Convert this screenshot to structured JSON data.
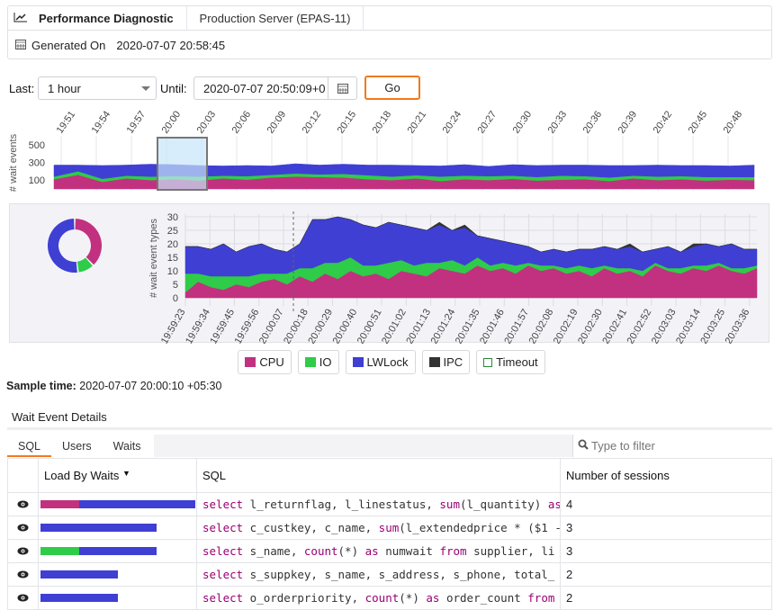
{
  "header": {
    "breadcrumb": [
      "Performance Diagnostic",
      "Production Server (EPAS-11)"
    ],
    "generated_label": "Generated On",
    "generated_value": "2020-07-07 20:58:45"
  },
  "controls": {
    "last_label": "Last:",
    "last_value": "1 hour",
    "until_label": "Until:",
    "until_value": "2020-07-07 20:50:09+0",
    "go_label": "Go"
  },
  "colors": {
    "CPU": "#c2317f",
    "IO": "#2ecc48",
    "LWLock": "#3f3fd4",
    "IPC": "#333333",
    "accent": "#f07a1e"
  },
  "chart_data": [
    {
      "type": "area",
      "stacked": true,
      "ylabel": "# wait events",
      "yticks": [
        100,
        300,
        500
      ],
      "ylim": [
        0,
        580
      ],
      "xticks": [
        "19:51",
        "19:54",
        "19:57",
        "20:00",
        "20:03",
        "20:06",
        "20:09",
        "20:12",
        "20:15",
        "20:18",
        "20:21",
        "20:24",
        "20:27",
        "20:30",
        "20:33",
        "20:36",
        "20:39",
        "20:42",
        "20:45",
        "20:48"
      ],
      "selection": [
        "20:00",
        "20:03"
      ],
      "series": [
        {
          "name": "CPU",
          "values": [
            110,
            160,
            80,
            120,
            100,
            110,
            95,
            120,
            105,
            130,
            140,
            135,
            130,
            110,
            100,
            120,
            90,
            110,
            100,
            115,
            95,
            105,
            110,
            90,
            120,
            100,
            110,
            95,
            105,
            100
          ]
        },
        {
          "name": "IO",
          "values": [
            30,
            40,
            35,
            30,
            40,
            35,
            45,
            30,
            40,
            30,
            35,
            30,
            40,
            45,
            40,
            35,
            50,
            40,
            45,
            35,
            40,
            45,
            35,
            40,
            30,
            40,
            35,
            40,
            30,
            35
          ]
        },
        {
          "name": "LWLock",
          "values": [
            130,
            70,
            150,
            120,
            140,
            130,
            125,
            110,
            120,
            100,
            110,
            105,
            110,
            115,
            130,
            110,
            120,
            125,
            110,
            125,
            130,
            120,
            125,
            135,
            115,
            130,
            120,
            130,
            125,
            135
          ]
        }
      ]
    },
    {
      "type": "area",
      "stacked": true,
      "ylabel": "# wait event types",
      "yticks": [
        0,
        5,
        10,
        15,
        20,
        25,
        30
      ],
      "ylim": [
        -3,
        31
      ],
      "xticks": [
        "19:59:23",
        "19:59:34",
        "19:59:45",
        "19:59:56",
        "20:00:07",
        "20:00:18",
        "20:00:29",
        "20:00:40",
        "20:00:51",
        "20:01:02",
        "20:01:13",
        "20:01:24",
        "20:01:35",
        "20:01:46",
        "20:01:57",
        "20:02:08",
        "20:02:19",
        "20:02:30",
        "20:02:41",
        "20:02:52",
        "20:03:03",
        "20:03:14",
        "20:03:25",
        "20:03:36"
      ],
      "marker": "20:00:10",
      "series": [
        {
          "name": "CPU",
          "values": [
            2,
            6,
            4,
            3,
            5,
            4,
            6,
            7,
            5,
            8,
            6,
            9,
            7,
            10,
            8,
            9,
            7,
            10,
            9,
            8,
            11,
            10,
            9,
            12,
            10,
            11,
            9,
            12,
            10,
            11,
            9,
            10,
            8,
            11,
            9,
            10,
            8,
            12,
            10,
            9,
            11,
            10,
            12,
            10,
            9,
            11
          ]
        },
        {
          "name": "IO",
          "values": [
            7,
            3,
            4,
            5,
            3,
            4,
            3,
            2,
            4,
            3,
            5,
            4,
            6,
            5,
            4,
            3,
            6,
            4,
            3,
            5,
            2,
            4,
            3,
            3,
            2,
            2,
            3,
            1,
            2,
            1,
            2,
            2,
            3,
            1,
            2,
            1,
            2,
            1,
            1,
            2,
            1,
            2,
            1,
            1,
            2,
            1
          ]
        },
        {
          "name": "LWLock",
          "values": [
            10,
            10,
            10,
            12,
            9,
            11,
            11,
            9,
            8,
            9,
            18,
            16,
            17,
            14,
            15,
            14,
            15,
            13,
            14,
            12,
            14,
            11,
            14,
            8,
            10,
            8,
            8,
            6,
            5,
            6,
            6,
            6,
            7,
            7,
            7,
            8,
            7,
            5,
            8,
            6,
            7,
            8,
            6,
            9,
            7,
            6
          ]
        },
        {
          "name": "IPC",
          "values": [
            0,
            0,
            0,
            0,
            0,
            0,
            0,
            0,
            0,
            0,
            0,
            0,
            0,
            0,
            0,
            0,
            0,
            0,
            0,
            0,
            1,
            0,
            1,
            0,
            0,
            0,
            0,
            0,
            0,
            0,
            0,
            0,
            0,
            0,
            0,
            1,
            0,
            0,
            0,
            0,
            1,
            0,
            0,
            0,
            0,
            0
          ]
        }
      ]
    },
    {
      "type": "pie",
      "donut": true,
      "series": [
        {
          "name": "CPU",
          "value": 38
        },
        {
          "name": "IO",
          "value": 10
        },
        {
          "name": "LWLock",
          "value": 52
        }
      ]
    }
  ],
  "legend": [
    {
      "name": "CPU",
      "icon": "filled"
    },
    {
      "name": "IO",
      "icon": "filled"
    },
    {
      "name": "LWLock",
      "icon": "filled"
    },
    {
      "name": "IPC",
      "icon": "filled"
    },
    {
      "name": "Timeout",
      "icon": "outline"
    }
  ],
  "sample": {
    "label": "Sample time:",
    "value": "2020-07-07 20:00:10 +05:30"
  },
  "details": {
    "title": "Wait Event Details",
    "tabs": [
      "SQL",
      "Users",
      "Waits"
    ],
    "active_tab": "SQL",
    "filter_placeholder": "Type to filter",
    "columns": [
      "Load By Waits",
      "SQL",
      "Number of sessions"
    ],
    "rows": [
      {
        "load": {
          "CPU": 1,
          "LWLock": 3
        },
        "sql": "select l_returnflag, l_linestatus, sum(l_quantity) as",
        "sessions": "4"
      },
      {
        "load": {
          "LWLock": 3
        },
        "sql": "select c_custkey, c_name, sum(l_extendedprice * ($1 -",
        "sessions": "3"
      },
      {
        "load": {
          "IO": 1,
          "LWLock": 2
        },
        "sql": "select s_name, count(*) as numwait from supplier, li",
        "sessions": "3"
      },
      {
        "load": {
          "LWLock": 2
        },
        "sql": "select s_suppkey, s_name, s_address, s_phone, total_",
        "sessions": "2"
      },
      {
        "load": {
          "LWLock": 2
        },
        "sql": "select o_orderpriority, count(*) as order_count from",
        "sessions": "2"
      }
    ]
  }
}
